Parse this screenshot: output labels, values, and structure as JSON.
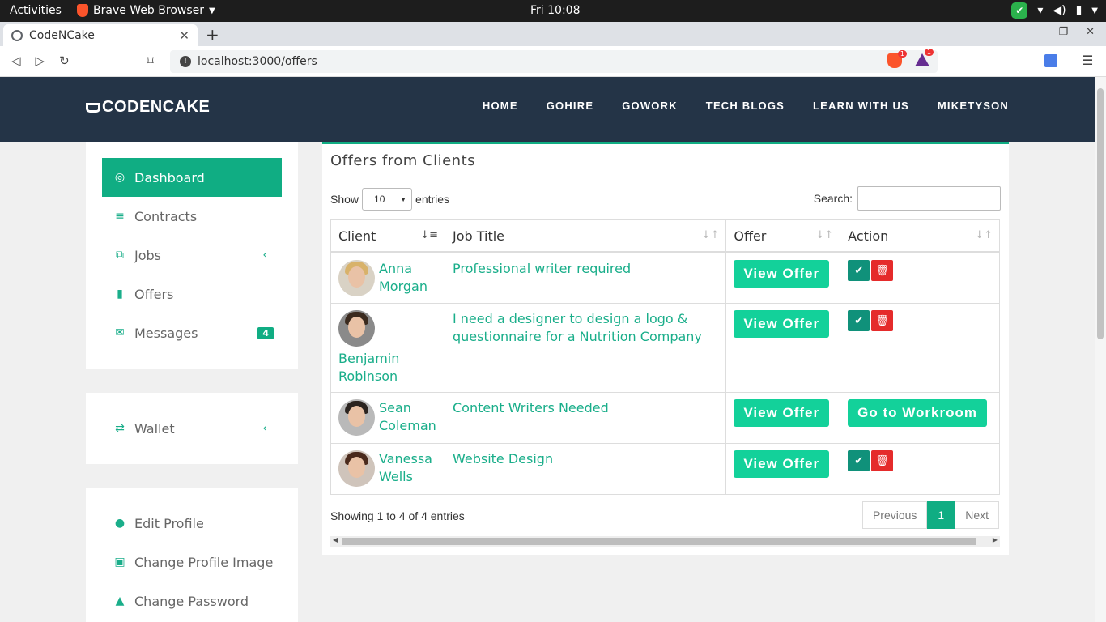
{
  "system": {
    "activities": "Activities",
    "app_name": "Brave Web Browser",
    "clock": "Fri 10:08"
  },
  "browser": {
    "tab_title": "CodeNCake",
    "url": "localhost:3000/offers",
    "ext_badge_1": "1",
    "ext_badge_2": "1"
  },
  "navbar": {
    "logo": "CODENCAKE",
    "links": [
      "HOME",
      "GOHIRE",
      "GOWORK",
      "TECH BLOGS",
      "LEARN WITH US",
      "MIKETYSON"
    ]
  },
  "sidebar": {
    "items": [
      {
        "label": "Dashboard",
        "icon": "life-ring-icon"
      },
      {
        "label": "Contracts",
        "icon": "align-left-icon"
      },
      {
        "label": "Jobs",
        "icon": "copy-icon"
      },
      {
        "label": "Offers",
        "icon": "file-icon"
      },
      {
        "label": "Messages",
        "icon": "envelope-icon",
        "badge": "4"
      }
    ],
    "wallet": {
      "label": "Wallet",
      "icon": "exchange-icon"
    },
    "account": [
      {
        "label": "Edit Profile",
        "icon": "user-icon"
      },
      {
        "label": "Change Profile Image",
        "icon": "image-icon"
      },
      {
        "label": "Change Password",
        "icon": "lock-icon"
      }
    ]
  },
  "main": {
    "title": "Offers from Clients",
    "show_label": "Show",
    "entries_value": "10",
    "entries_label": "entries",
    "search_label": "Search:",
    "columns": [
      "Client",
      "Job Title",
      "Offer",
      "Action"
    ],
    "rows": [
      {
        "client": "Anna Morgan",
        "job": "Professional writer required",
        "offer": "View Offer",
        "action": "buttons"
      },
      {
        "client": "Benjamin Robinson",
        "job": "I need a designer to design a logo & questionnaire for a Nutrition Company",
        "offer": "View Offer",
        "action": "buttons"
      },
      {
        "client": "Sean Coleman",
        "job": "Content Writers Needed",
        "offer": "View Offer",
        "action": "Go to Workroom"
      },
      {
        "client": "Vanessa Wells",
        "job": "Website Design",
        "offer": "View Offer",
        "action": "buttons"
      }
    ],
    "showing": "Showing 1 to 4 of 4 entries",
    "pager": {
      "prev": "Previous",
      "current": "1",
      "next": "Next"
    }
  },
  "colors": {
    "accent": "#10ad83",
    "navbar": "#243447",
    "button": "#13d19a",
    "danger": "#e52b2b"
  }
}
